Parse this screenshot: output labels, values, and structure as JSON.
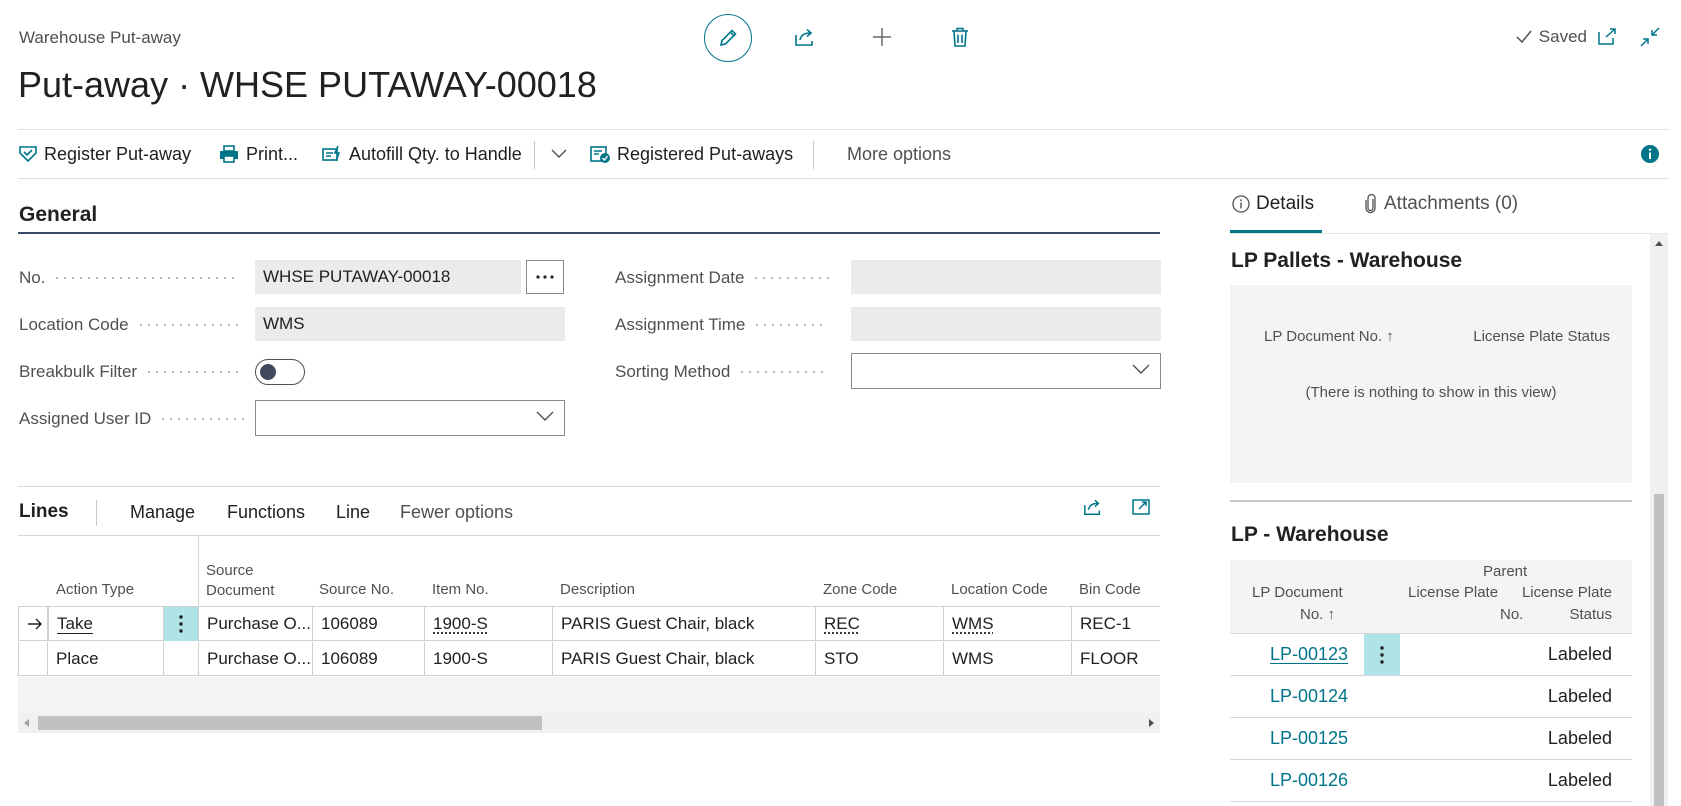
{
  "header": {
    "breadcrumb": "Warehouse Put-away",
    "title": "Put-away · WHSE PUTAWAY-00018",
    "saved_label": "Saved"
  },
  "actions": {
    "register": "Register Put-away",
    "print": "Print...",
    "autofill": "Autofill Qty. to Handle",
    "registered": "Registered Put-aways",
    "more": "More options"
  },
  "general": {
    "title": "General",
    "no_label": "No.",
    "no_value": "WHSE PUTAWAY-00018",
    "location_label": "Location Code",
    "location_value": "WMS",
    "breakbulk_label": "Breakbulk Filter",
    "breakbulk_on": false,
    "user_label": "Assigned User ID",
    "user_value": "",
    "date_label": "Assignment Date",
    "date_value": "",
    "time_label": "Assignment Time",
    "time_value": "",
    "sorting_label": "Sorting Method",
    "sorting_value": ""
  },
  "lines": {
    "title": "Lines",
    "menu": [
      "Manage",
      "Functions",
      "Line",
      "Fewer options"
    ],
    "columns": {
      "action_type": "Action Type",
      "source_doc_1": "Source",
      "source_doc_2": "Document",
      "source_no": "Source No.",
      "item_no": "Item No.",
      "description": "Description",
      "zone": "Zone Code",
      "location": "Location Code",
      "bin": "Bin Code"
    },
    "rows": [
      {
        "action": "Take",
        "source_doc": "Purchase O...",
        "source_no": "106089",
        "item": "1900-S",
        "description": "PARIS Guest Chair, black",
        "zone": "REC",
        "location": "WMS",
        "bin": "REC-1"
      },
      {
        "action": "Place",
        "source_doc": "Purchase O...",
        "source_no": "106089",
        "item": "1900-S",
        "description": "PARIS Guest Chair, black",
        "zone": "STO",
        "location": "WMS",
        "bin": "FLOOR"
      }
    ]
  },
  "factbox": {
    "tab_details": "Details",
    "tab_attachments": "Attachments (0)",
    "pallets": {
      "title": "LP Pallets - Warehouse",
      "col_doc": "LP Document No. ↑",
      "col_status": "License Plate Status",
      "empty": "(There is nothing to show in this view)"
    },
    "lp": {
      "title": "LP - Warehouse",
      "col_doc_1": "LP Document",
      "col_doc_2": "No. ↑",
      "col_parent_1": "Parent",
      "col_parent_2": "License Plate",
      "col_parent_3": "No.",
      "col_status_1": "License Plate",
      "col_status_2": "Status",
      "rows": [
        {
          "doc": "LP-00123",
          "status": "Labeled"
        },
        {
          "doc": "LP-00124",
          "status": "Labeled"
        },
        {
          "doc": "LP-00125",
          "status": "Labeled"
        },
        {
          "doc": "LP-00126",
          "status": "Labeled"
        }
      ]
    }
  },
  "colors": {
    "accent": "#00758a",
    "selected_cell": "#aee3e8",
    "readonly_field": "#ebebeb"
  }
}
